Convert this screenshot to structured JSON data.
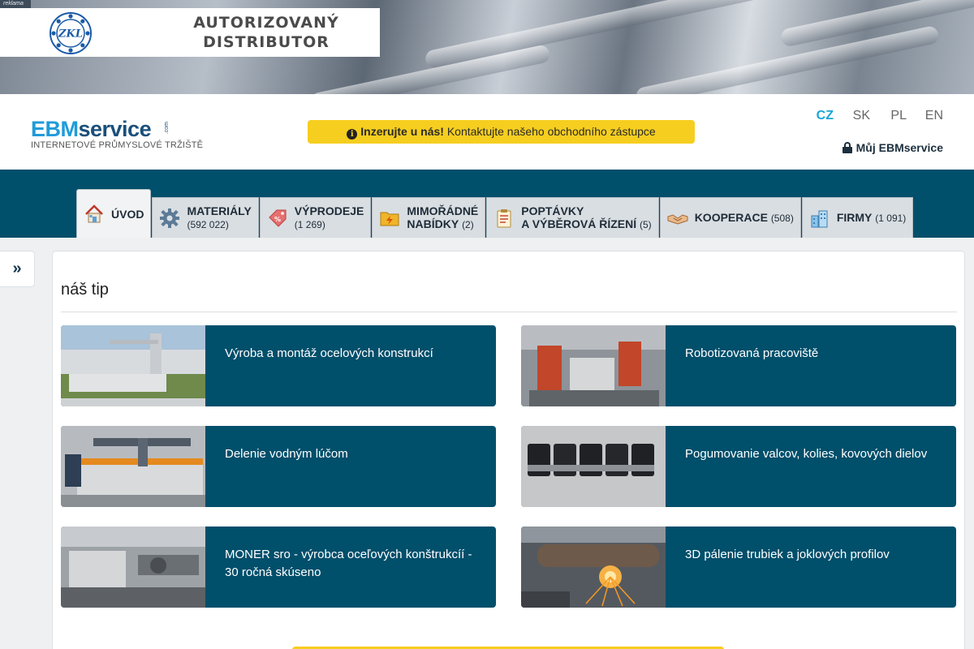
{
  "banner": {
    "ad_label": "reklama",
    "logo_text": "ZKL",
    "headline_line1": "AUTORIZOVANÝ",
    "headline_line2": "DISTRIBUTOR"
  },
  "header": {
    "logo_ebm": "EBM",
    "logo_service": "service",
    "logo_com": ".com",
    "logo_tagline": "INTERNETOVÉ PRŮMYSLOVÉ TRŽIŠTĚ",
    "notice_bold": "Inzerujte u nás!",
    "notice_text": "Kontaktujte našeho obchodního zástupce",
    "languages": [
      "CZ",
      "SK",
      "PL",
      "EN"
    ],
    "active_language": "CZ",
    "account_label": "Můj EBMservice"
  },
  "nav": {
    "tabs": [
      {
        "label": "ÚVOD",
        "label2": "",
        "count": "",
        "icon": "home-icon"
      },
      {
        "label": "MATERIÁLY",
        "label2": "",
        "count": "(592 022)",
        "icon": "gear-icon"
      },
      {
        "label": "VÝPRODEJE",
        "label2": "",
        "count": "(1 269)",
        "icon": "sale-tag-icon"
      },
      {
        "label": "MIMOŘÁDNÉ",
        "label2": "NABÍDKY",
        "count": "(2)",
        "icon": "lightning-folder-icon"
      },
      {
        "label": "POPTÁVKY",
        "label2": "A VÝBĚROVÁ ŘÍZENÍ",
        "count": "(5)",
        "icon": "clipboard-icon"
      },
      {
        "label": "KOOPERACE",
        "label2": "",
        "count": "(508)",
        "icon": "handshake-icon"
      },
      {
        "label": "FIRMY",
        "label2": "",
        "count": "(1 091)",
        "icon": "buildings-icon"
      }
    ]
  },
  "sidebar": {
    "toggle_symbol": "»"
  },
  "main": {
    "section_title": "náš tip",
    "cards": [
      {
        "title": "Výroba a montáž ocelových konstrukcí"
      },
      {
        "title": "Robotizovaná pracoviště"
      },
      {
        "title": "Delenie vodným lúčom"
      },
      {
        "title": "Pogumovanie valcov, kolies, kovových dielov"
      },
      {
        "title": "MONER sro - výrobca oceľových konštrukcíí - 30 ročná skúseno"
      },
      {
        "title": "3D pálenie trubiek a joklových profilov"
      }
    ]
  },
  "colors": {
    "brand_blue": "#004f6b",
    "accent_yellow": "#f6ce1f",
    "logo_light_blue": "#1f9cd9",
    "active_language": "#17a6d8"
  }
}
